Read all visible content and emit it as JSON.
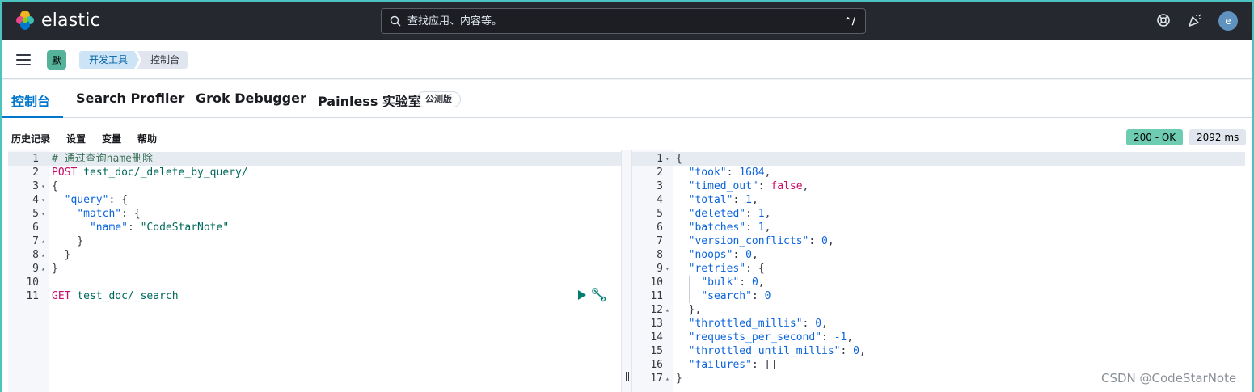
{
  "header": {
    "brand": "elastic",
    "search_placeholder": "查找应用、内容等。",
    "shortcut": "⌃/",
    "avatar_initial": "e",
    "icons": [
      "help-icon",
      "news-feed-icon"
    ]
  },
  "breadcrumbs": {
    "space_initial": "默",
    "items": [
      "开发工具",
      "控制台"
    ]
  },
  "tabs": [
    {
      "label": "控制台",
      "active": true
    },
    {
      "label": "Search Profiler",
      "active": false
    },
    {
      "label": "Grok Debugger",
      "active": false
    },
    {
      "label": "Painless 实验室",
      "active": false,
      "badge": "公测版"
    }
  ],
  "toolbar": {
    "history": "历史记录",
    "settings": "设置",
    "variables": "变量",
    "help": "帮助",
    "status": "200 - OK",
    "elapsed": "2092 ms"
  },
  "request_editor": {
    "lines": [
      {
        "n": "1",
        "fold": "",
        "parts": [
          [
            "c-comment",
            "# 通过查询name删除"
          ]
        ]
      },
      {
        "n": "2",
        "fold": "",
        "parts": [
          [
            "c-method",
            "POST"
          ],
          [
            "c-punc",
            " "
          ],
          [
            "c-url",
            "test_doc/_delete_by_query/"
          ]
        ]
      },
      {
        "n": "3",
        "fold": "▾",
        "parts": [
          [
            "c-punc",
            "{"
          ]
        ]
      },
      {
        "n": "4",
        "fold": "▾",
        "parts": [
          [
            "c-punc",
            "  "
          ],
          [
            "c-key",
            "\"query\""
          ],
          [
            "c-punc",
            ": {"
          ]
        ]
      },
      {
        "n": "5",
        "fold": "▾",
        "parts": [
          [
            "c-punc",
            "    "
          ],
          [
            "c-key",
            "\"match\""
          ],
          [
            "c-punc",
            ": {"
          ]
        ]
      },
      {
        "n": "6",
        "fold": "",
        "parts": [
          [
            "c-punc",
            "      "
          ],
          [
            "c-key",
            "\"name\""
          ],
          [
            "c-punc",
            ": "
          ],
          [
            "c-str",
            "\"CodeStarNote\""
          ]
        ]
      },
      {
        "n": "7",
        "fold": "▴",
        "parts": [
          [
            "c-punc",
            "    }"
          ]
        ]
      },
      {
        "n": "8",
        "fold": "▴",
        "parts": [
          [
            "c-punc",
            "  }"
          ]
        ]
      },
      {
        "n": "9",
        "fold": "▴",
        "parts": [
          [
            "c-punc",
            "}"
          ]
        ]
      },
      {
        "n": "10",
        "fold": "",
        "parts": []
      },
      {
        "n": "11",
        "fold": "",
        "parts": [
          [
            "c-method",
            "GET"
          ],
          [
            "c-punc",
            " "
          ],
          [
            "c-url",
            "test_doc/_search"
          ]
        ]
      }
    ]
  },
  "response_editor": {
    "lines": [
      {
        "n": "1",
        "fold": "▾",
        "parts": [
          [
            "c-punc",
            "{"
          ]
        ]
      },
      {
        "n": "2",
        "fold": "",
        "parts": [
          [
            "c-punc",
            "  "
          ],
          [
            "c-key",
            "\"took\""
          ],
          [
            "c-punc",
            ": "
          ],
          [
            "c-num",
            "1684"
          ],
          [
            "c-punc",
            ","
          ]
        ]
      },
      {
        "n": "3",
        "fold": "",
        "parts": [
          [
            "c-punc",
            "  "
          ],
          [
            "c-key",
            "\"timed_out\""
          ],
          [
            "c-punc",
            ": "
          ],
          [
            "c-bool",
            "false"
          ],
          [
            "c-punc",
            ","
          ]
        ]
      },
      {
        "n": "4",
        "fold": "",
        "parts": [
          [
            "c-punc",
            "  "
          ],
          [
            "c-key",
            "\"total\""
          ],
          [
            "c-punc",
            ": "
          ],
          [
            "c-num",
            "1"
          ],
          [
            "c-punc",
            ","
          ]
        ]
      },
      {
        "n": "5",
        "fold": "",
        "parts": [
          [
            "c-punc",
            "  "
          ],
          [
            "c-key",
            "\"deleted\""
          ],
          [
            "c-punc",
            ": "
          ],
          [
            "c-num",
            "1"
          ],
          [
            "c-punc",
            ","
          ]
        ]
      },
      {
        "n": "6",
        "fold": "",
        "parts": [
          [
            "c-punc",
            "  "
          ],
          [
            "c-key",
            "\"batches\""
          ],
          [
            "c-punc",
            ": "
          ],
          [
            "c-num",
            "1"
          ],
          [
            "c-punc",
            ","
          ]
        ]
      },
      {
        "n": "7",
        "fold": "",
        "parts": [
          [
            "c-punc",
            "  "
          ],
          [
            "c-key",
            "\"version_conflicts\""
          ],
          [
            "c-punc",
            ": "
          ],
          [
            "c-num",
            "0"
          ],
          [
            "c-punc",
            ","
          ]
        ]
      },
      {
        "n": "8",
        "fold": "",
        "parts": [
          [
            "c-punc",
            "  "
          ],
          [
            "c-key",
            "\"noops\""
          ],
          [
            "c-punc",
            ": "
          ],
          [
            "c-num",
            "0"
          ],
          [
            "c-punc",
            ","
          ]
        ]
      },
      {
        "n": "9",
        "fold": "▾",
        "parts": [
          [
            "c-punc",
            "  "
          ],
          [
            "c-key",
            "\"retries\""
          ],
          [
            "c-punc",
            ": {"
          ]
        ]
      },
      {
        "n": "10",
        "fold": "",
        "parts": [
          [
            "c-punc",
            "    "
          ],
          [
            "c-key",
            "\"bulk\""
          ],
          [
            "c-punc",
            ": "
          ],
          [
            "c-num",
            "0"
          ],
          [
            "c-punc",
            ","
          ]
        ]
      },
      {
        "n": "11",
        "fold": "",
        "parts": [
          [
            "c-punc",
            "    "
          ],
          [
            "c-key",
            "\"search\""
          ],
          [
            "c-punc",
            ": "
          ],
          [
            "c-num",
            "0"
          ]
        ]
      },
      {
        "n": "12",
        "fold": "▴",
        "parts": [
          [
            "c-punc",
            "  },"
          ]
        ]
      },
      {
        "n": "13",
        "fold": "",
        "parts": [
          [
            "c-punc",
            "  "
          ],
          [
            "c-key",
            "\"throttled_millis\""
          ],
          [
            "c-punc",
            ": "
          ],
          [
            "c-num",
            "0"
          ],
          [
            "c-punc",
            ","
          ]
        ]
      },
      {
        "n": "14",
        "fold": "",
        "parts": [
          [
            "c-punc",
            "  "
          ],
          [
            "c-key",
            "\"requests_per_second\""
          ],
          [
            "c-punc",
            ": "
          ],
          [
            "c-num",
            "-1"
          ],
          [
            "c-punc",
            ","
          ]
        ]
      },
      {
        "n": "15",
        "fold": "",
        "parts": [
          [
            "c-punc",
            "  "
          ],
          [
            "c-key",
            "\"throttled_until_millis\""
          ],
          [
            "c-punc",
            ": "
          ],
          [
            "c-num",
            "0"
          ],
          [
            "c-punc",
            ","
          ]
        ]
      },
      {
        "n": "16",
        "fold": "",
        "parts": [
          [
            "c-punc",
            "  "
          ],
          [
            "c-key",
            "\"failures\""
          ],
          [
            "c-punc",
            ": []"
          ]
        ]
      },
      {
        "n": "17",
        "fold": "▴",
        "parts": [
          [
            "c-punc",
            "}"
          ]
        ]
      }
    ]
  },
  "watermark": "CSDN @CodeStarNote",
  "colors": {
    "accent": "#0077cc",
    "header_bg": "#25282f",
    "status_ok": "#6dccb1",
    "frame": "#4cc3c0"
  }
}
